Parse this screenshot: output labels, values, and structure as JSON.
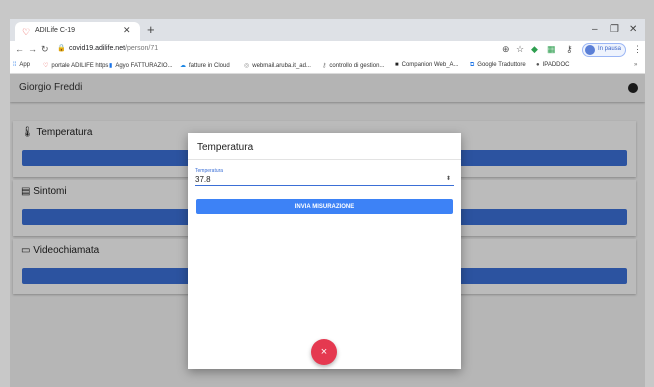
{
  "browser": {
    "tab_title": "ADILife C-19",
    "new_tab": "+",
    "controls": {
      "minimize": "–",
      "restore": "❐",
      "close": "✕"
    },
    "url_domain": "covid19.adilife.net",
    "url_path": "/person/71",
    "profile_label": "In pausa"
  },
  "bookmarks": [
    {
      "icon": "apps-icon",
      "label": "App"
    },
    {
      "icon": "heart-icon",
      "label": "portale ADILIFE https"
    },
    {
      "icon": "aruba-icon",
      "label": "Agyo FATTURAZIO..."
    },
    {
      "icon": "cloud-icon",
      "label": "fatture in Cloud"
    },
    {
      "icon": "mail-icon",
      "label": "webmail.aruba.it_ad..."
    },
    {
      "icon": "key-icon",
      "label": "controllo di gestion..."
    },
    {
      "icon": "companion-icon",
      "label": "Companion Web_A..."
    },
    {
      "icon": "translate-icon",
      "label": "Google Traduttore"
    },
    {
      "icon": "ipad-icon",
      "label": "IPADDOC"
    }
  ],
  "app": {
    "patient_name": "Giorgio Freddi",
    "cards": [
      {
        "icon": "thermometer-icon",
        "icon_glyph": "🌡",
        "title": "Temperatura"
      },
      {
        "icon": "symptoms-icon",
        "icon_glyph": "▤",
        "title": "Sintomi"
      },
      {
        "icon": "videocall-icon",
        "icon_glyph": "▭",
        "title": "Videochiamata"
      }
    ]
  },
  "dialog": {
    "title": "Temperatura",
    "field_label": "Temperatura",
    "field_value": "37.8",
    "submit_label": "INVIA MISURAZIONE",
    "close_glyph": "×"
  },
  "colors": {
    "accent": "#3b6fd6",
    "submit": "#3d82f6",
    "fab": "#e53950"
  }
}
